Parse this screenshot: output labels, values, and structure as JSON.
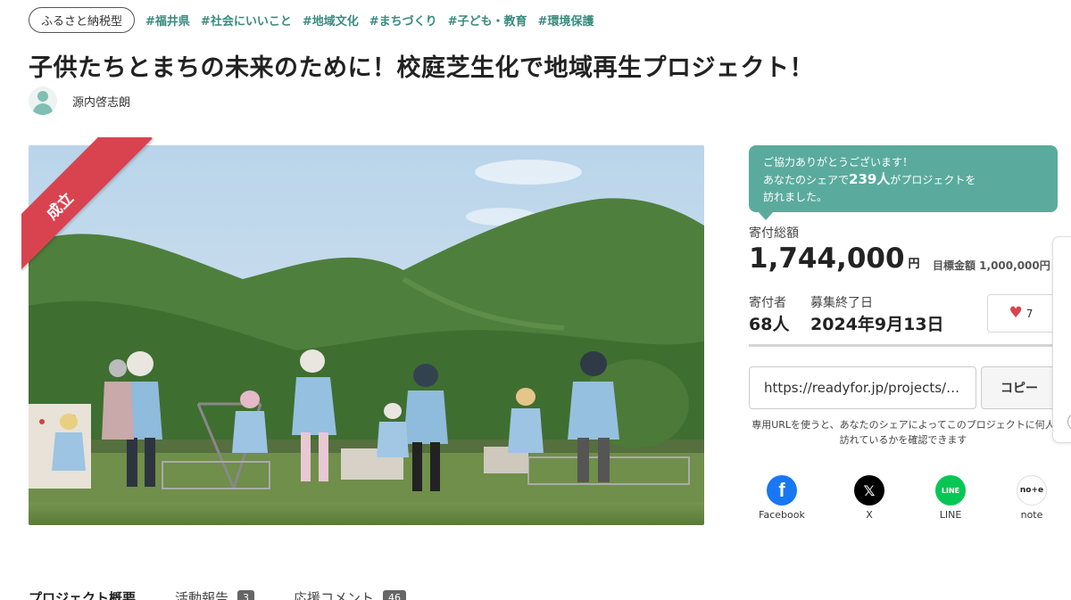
{
  "tags": {
    "type_pill": "ふるさと納税型",
    "items": [
      "#福井県",
      "#社会にいいこと",
      "#地域文化",
      "#まちづくり",
      "#子ども・教育",
      "#環境保護"
    ]
  },
  "project": {
    "title": "子供たちとまちの未来のために！校庭芝生化で地域再生プロジェクト！",
    "author": "源内啓志朗",
    "ribbon": "成立"
  },
  "share_bubble": {
    "line1": "ご協力ありがとうございます！",
    "line2_pre": "あなたのシェアで",
    "count": "239人",
    "line2_post": "がプロジェクトを",
    "line3": "訪れました。"
  },
  "stats": {
    "total_label": "寄付総額",
    "total_value": "1,744,000",
    "total_unit": "円",
    "goal_text": "目標金額 1,000,000円",
    "donors_label": "寄付者",
    "donors_value": "68人",
    "end_label": "募集終了日",
    "end_value": "2024年9月13日",
    "likes": "7"
  },
  "share_url": {
    "url": "https://readyfor.jp/projects/…",
    "copy_label": "コピー",
    "note": "専用URLを使うと、あなたのシェアによってこのプロジェクトに何人訪れているかを確認できます"
  },
  "share_buttons": [
    {
      "label": "Facebook",
      "icon": "facebook-icon",
      "color": "#1877f2"
    },
    {
      "label": "X",
      "icon": "x-icon",
      "color": "#000000"
    },
    {
      "label": "LINE",
      "icon": "line-icon",
      "color": "#06c755"
    },
    {
      "label": "note",
      "icon": "note-icon",
      "color": "#ffffff"
    }
  ],
  "bottom_tabs": {
    "overview": "プロジェクト概要",
    "reports": "活動報告",
    "reports_count": "3",
    "comments": "応援コメント",
    "comments_count": "46"
  },
  "colors": {
    "accent": "#5aab9d",
    "ribbon": "#d9434f",
    "tag_text": "#3a8a7e"
  }
}
